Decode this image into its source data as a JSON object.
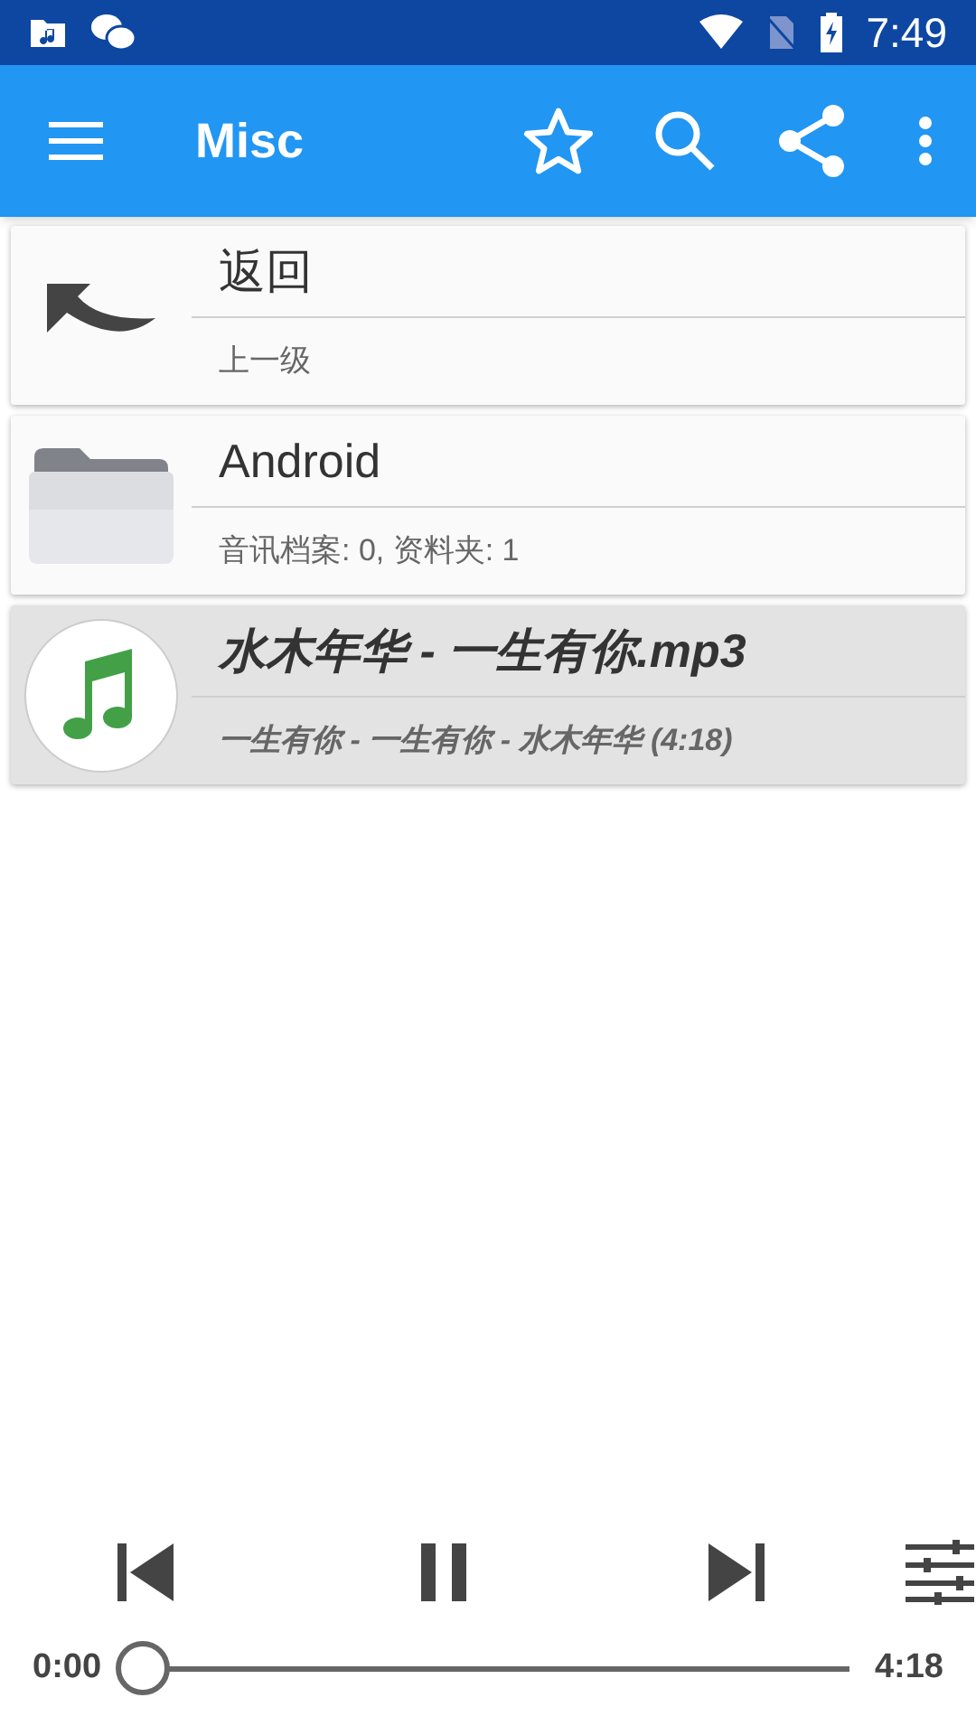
{
  "status_bar": {
    "time": "7:49"
  },
  "app_bar": {
    "title": "Misc"
  },
  "items": [
    {
      "kind": "back",
      "title": "返回",
      "subtitle": "上一级",
      "selected": false
    },
    {
      "kind": "folder",
      "title": "Android",
      "subtitle": "音讯档案: 0, 资料夹: 1",
      "selected": false
    },
    {
      "kind": "audio",
      "title": "水木年华 - 一生有你.mp3",
      "subtitle": "一生有你 - 一生有你 - 水木年华 (4:18)",
      "selected": true
    }
  ],
  "player": {
    "playing": true,
    "elapsed": "0:00",
    "duration": "4:18",
    "level": 0
  }
}
